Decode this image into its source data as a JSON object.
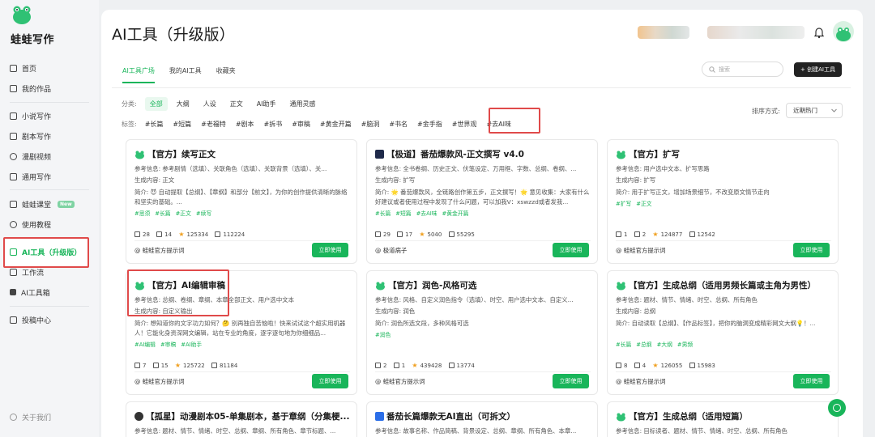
{
  "sidebar": {
    "brand": "蛙蛙写作",
    "items": [
      {
        "label": "首页"
      },
      {
        "label": "我的作品"
      },
      {
        "label": "小说写作"
      },
      {
        "label": "剧本写作"
      },
      {
        "label": "漫剧视频"
      },
      {
        "label": "通用写作"
      },
      {
        "label": "蛙蛙课堂",
        "badge": "New"
      },
      {
        "label": "使用教程"
      },
      {
        "label": "AI工具（升级版）"
      },
      {
        "label": "工作流"
      },
      {
        "label": "AI工具箱"
      },
      {
        "label": "投稿中心"
      }
    ],
    "about": "关于我们"
  },
  "header": {
    "title": "AI工具（升级版）"
  },
  "tabs": [
    "AI工具广场",
    "我的AI工具",
    "收藏夹"
  ],
  "search": {
    "placeholder": "搜索"
  },
  "create_button": "+ 创建AI工具",
  "category": {
    "label": "分类:",
    "options": [
      "全部",
      "大纲",
      "人设",
      "正文",
      "AI助手",
      "通用灵感"
    ]
  },
  "tag_filter": {
    "label": "标签:",
    "options": [
      "#长篇",
      "#短篇",
      "#老福特",
      "#剧本",
      "#拆书",
      "#审稿",
      "#黄金开篇",
      "#脑洞",
      "#书名",
      "#金手指",
      "#世界观",
      "#去AI味"
    ]
  },
  "sort": {
    "label": "排序方式:",
    "value": "近期热门"
  },
  "cards": [
    {
      "title": "【官方】续写正文",
      "ref": "参考信息: 参考剧情（选填）、关联角色（选填）、关联背景（选填）、关...",
      "gen": "生成内容: 正文",
      "desc": "简介: 😈 自动提取【总纲】、【章纲】和部分【前文】，为你的创作提供清晰的脉络和坚实的基础。...",
      "tags": [
        "#思须",
        "#长篇",
        "#正文",
        "#续写"
      ],
      "likes": "28",
      "shares": "14",
      "stars": "125334",
      "uses": "112224",
      "author": "蛙蛙官方提示词",
      "button": "立即使用"
    },
    {
      "title": "【极道】番茄爆款风-正文撰写 v4.0",
      "ref": "参考信息: 全书卷纲、历史正文、伏笔设定、万用框、字数、总纲、卷纲、...",
      "gen": "生成内容: 扩写",
      "desc": "简介: 🌟 番茄爆款风，全链路创作第五步，正文撰写！🌟 意见收集：大家有什么好建议或者使用过程中发现了什么问题，可以加我V：xswzzd或者发我...",
      "tags": [
        "#长篇",
        "#短篇",
        "#去AI味",
        "#黄金开篇"
      ],
      "likes": "29",
      "shares": "17",
      "stars": "5040",
      "uses": "55295",
      "author": "极道病子",
      "button": "立即使用"
    },
    {
      "title": "【官方】扩写",
      "ref": "参考信息: 用户选中文本、扩写思路",
      "gen": "生成内容: 扩写",
      "desc": "简介: 用于扩写正文，增加场景细节，不改变原文情节走向",
      "tags": [
        "#扩写",
        "#正文"
      ],
      "likes": "1",
      "shares": "2",
      "stars": "124877",
      "uses": "12542",
      "author": "蛙蛙官方提示词",
      "button": "立即使用"
    },
    {
      "title": "【官方】AI编辑审稿",
      "ref": "参考信息: 总纲、卷纲、章纲、本章全部正文、用户选中文本",
      "gen": "生成内容: 自定义输出",
      "desc": "简介: 想知道你的文字功力如何？🤔 别再独自苦恼啦！快来试试这个超实用机器人！它能化身资深网文编辑，站在专业的角度，逐字逐句地为你细细品...",
      "tags": [
        "#AI编辑",
        "#审稿",
        "#AI助手"
      ],
      "likes": "7",
      "shares": "15",
      "stars": "125722",
      "uses": "81184",
      "author": "蛙蛙官方提示词",
      "button": "立即使用"
    },
    {
      "title": "【官方】润色-风格可选",
      "ref": "参考信息: 风格、自定义润色指令（选填）、时空、用户选中文本、自定义...",
      "gen": "生成内容: 润色",
      "desc": "简介: 润色所选文段，多种风格可选",
      "tags": [
        "#润色"
      ],
      "likes": "2",
      "shares": "1",
      "stars": "439428",
      "uses": "13774",
      "author": "蛙蛙官方提示词",
      "button": "立即使用"
    },
    {
      "title": "【官方】生成总纲（适用男频长篇或主角为男性）",
      "ref": "参考信息: 题材、情节、情绪、时空、总纲、所有角色",
      "gen": "生成内容: 总纲",
      "desc": "简介: 自动读取【总纲】、【作品标签】，把你的脑洞变成精彩网文大纲💡！...",
      "tags": [
        "#长篇",
        "#总纲",
        "#大纲",
        "#男频"
      ],
      "likes": "8",
      "shares": "4",
      "stars": "126055",
      "uses": "15983",
      "author": "蛙蛙官方提示词",
      "button": "立即使用"
    },
    {
      "title": "【孤星】动漫剧本05-单集剧本，基于章纲（分集梗...",
      "ref": "参考信息: 题材、情节、情绪、时空、总纲、章纲、所有角色、章节标题、..."
    },
    {
      "title": "番茄长篇爆款无AI直出（可拆文）",
      "ref": "参考信息: 故事名称、作品简稿、背景设定、总纲、章纲、所有角色、本章..."
    },
    {
      "title": "【官方】生成总纲（适用短篇）",
      "ref": "参考信息: 目标读者、题材、情节、情绪、时空、总纲、所有角色"
    }
  ]
}
